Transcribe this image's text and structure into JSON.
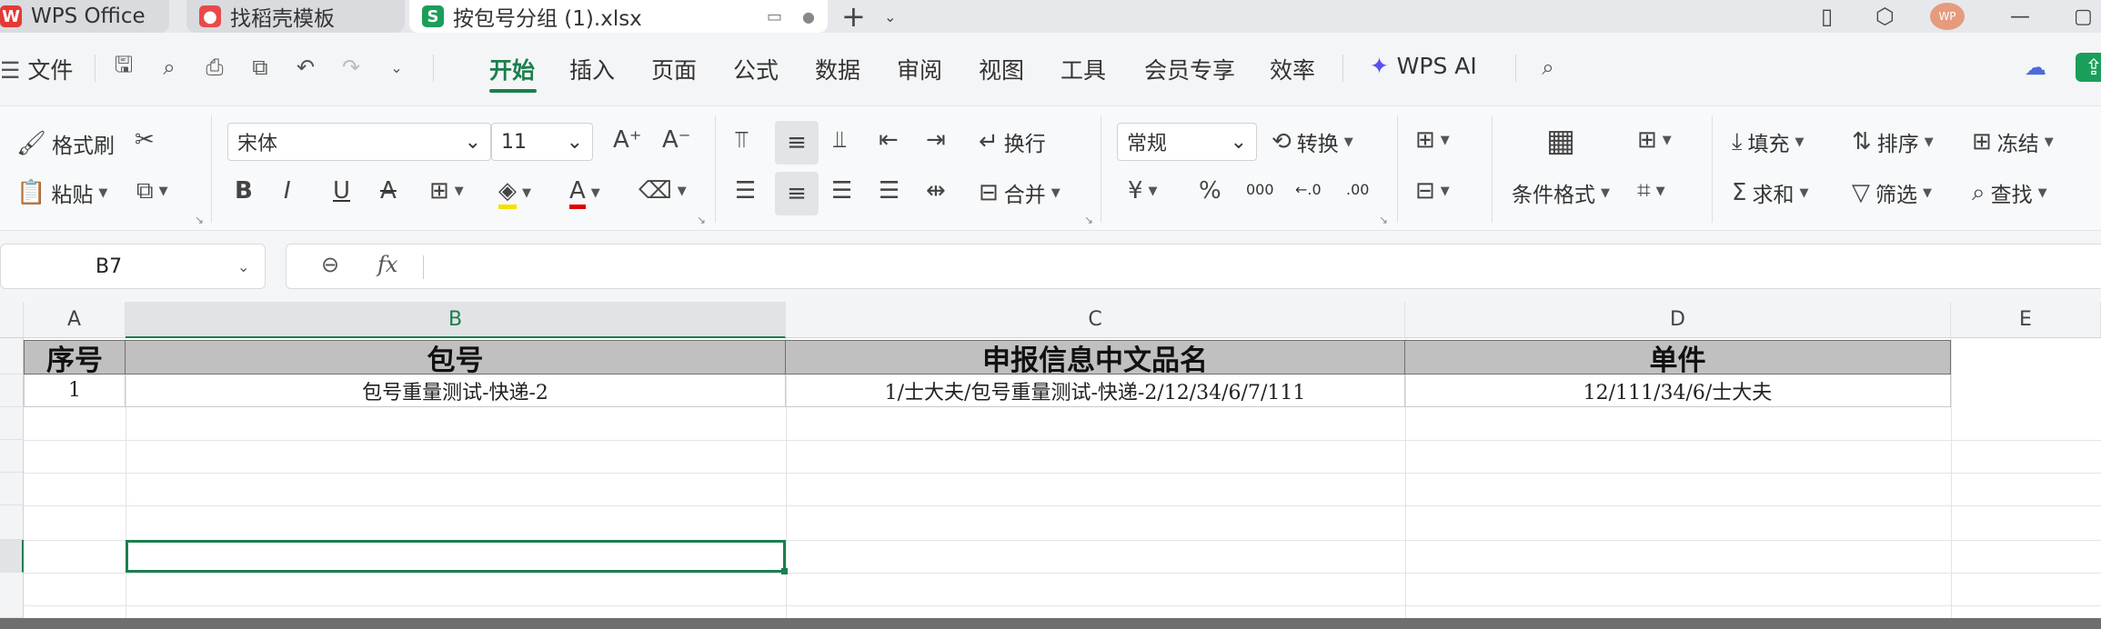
{
  "titlebar": {
    "tabs": [
      {
        "label": "WPS Office",
        "icon": "wps-logo-icon",
        "color": "#e53935"
      },
      {
        "label": "找稻壳模板",
        "icon": "docer-icon",
        "color": "#e84a4a"
      },
      {
        "label": "按包号分组 (1).xlsx",
        "icon": "spreadsheet-icon",
        "color": "#1b9e5a",
        "icon_text": "S"
      }
    ],
    "avatar_text": "WP"
  },
  "menu": {
    "file_label": "文件",
    "tabs": [
      "开始",
      "插入",
      "页面",
      "公式",
      "数据",
      "审阅",
      "视图",
      "工具",
      "会员专享",
      "效率"
    ],
    "active_tab": "开始",
    "ai_label": "WPS AI"
  },
  "ribbon": {
    "format_painter": "格式刷",
    "paste": "粘贴",
    "font_name": "宋体",
    "font_size": "11",
    "wrap_text": "换行",
    "merge": "合并",
    "number_format": "常规",
    "convert": "转换",
    "conditional_format": "条件格式",
    "fill": "填充",
    "sort": "排序",
    "freeze": "冻结",
    "sum": "求和",
    "filter": "筛选",
    "find": "查找",
    "bold": "B",
    "italic": "I",
    "underline": "U",
    "strike": "A",
    "font_color_glyph": "A",
    "currency_glyph": "¥",
    "percent_glyph": "%",
    "thousands_glyph": "000",
    "inc_decimal": "←.0",
    "dec_decimal": ".00"
  },
  "formula_bar": {
    "cell_ref": "B7",
    "fx_label": "fx",
    "formula": ""
  },
  "sheet": {
    "columns": [
      "A",
      "B",
      "C",
      "D",
      "E"
    ],
    "selected_column": "B",
    "header_row": [
      "序号",
      "包号",
      "申报信息中文品名",
      "单件"
    ],
    "data_rows": [
      [
        "1",
        "包号重量测试-快递-2",
        "1/士大夫/包号重量测试-快递-2/12/34/6/7/111",
        "12/111/34/6/士大夫"
      ]
    ],
    "active_cell": "B7"
  },
  "colors": {
    "accent": "#1b7f4e",
    "header_fill": "#c0c0c0"
  }
}
